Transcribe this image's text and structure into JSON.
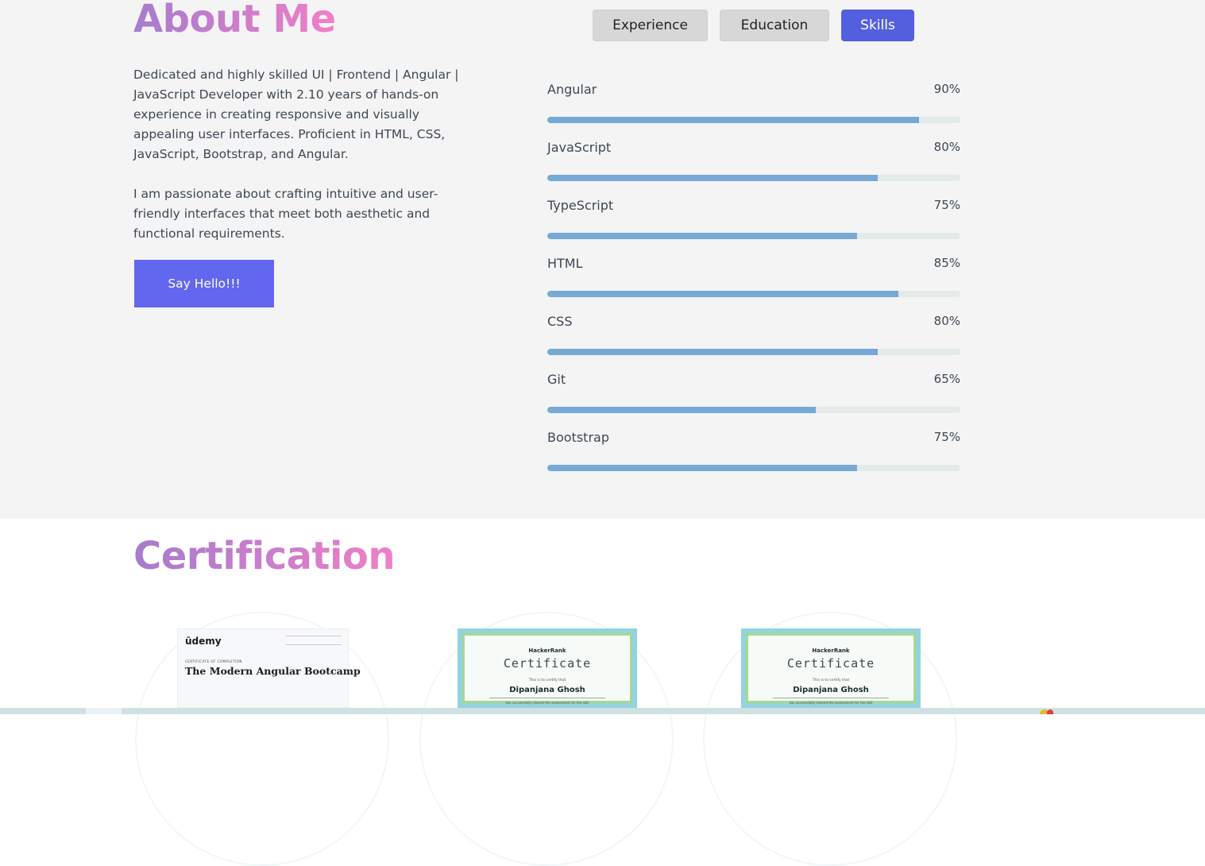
{
  "about": {
    "title": "About Me",
    "paragraph1": "Dedicated and highly skilled UI | Frontend | Angular | JavaScript Developer with 2.10 years of hands-on experience in creating responsive and visually appealing user interfaces. Proficient in HTML, CSS, JavaScript, Bootstrap, and Angular.",
    "paragraph2": "I am passionate about crafting intuitive and user-friendly interfaces that meet both aesthetic and functional requirements.",
    "cta_label": "Say Hello!!!"
  },
  "tabs": [
    {
      "label": "Experience",
      "active": false
    },
    {
      "label": "Education",
      "active": false
    },
    {
      "label": "Skills",
      "active": true
    }
  ],
  "skills": [
    {
      "name": "Angular",
      "percent_label": "90%",
      "percent": 90
    },
    {
      "name": "JavaScript",
      "percent_label": "80%",
      "percent": 80
    },
    {
      "name": "TypeScript",
      "percent_label": "75%",
      "percent": 75
    },
    {
      "name": "HTML",
      "percent_label": "85%",
      "percent": 85
    },
    {
      "name": "CSS",
      "percent_label": "80%",
      "percent": 80
    },
    {
      "name": "Git",
      "percent_label": "65%",
      "percent": 65
    },
    {
      "name": "Bootstrap",
      "percent_label": "75%",
      "percent": 75
    }
  ],
  "certification": {
    "title": "Certification",
    "cards": [
      {
        "issuer": "ūdemy",
        "course": "The Modern Angular Bootcamp",
        "caption": "CERTIFICATE OF COMPLETION"
      },
      {
        "issuer": "HackerRank",
        "heading": "Certificate",
        "certify": "This is to certify that",
        "name": "Dipanjana Ghosh",
        "sub": "has successfully cleared the assessment for the skill"
      },
      {
        "issuer": "HackerRank",
        "heading": "Certificate",
        "certify": "This is to certify that",
        "name": "Dipanjana Ghosh",
        "sub": "has successfully cleared the assessment for the skill"
      }
    ]
  },
  "colors": {
    "accent": "#6366ef",
    "active_tab": "#545fe0",
    "bar_fill": "#76a9d6",
    "bar_track": "#e4e9e9",
    "title_gradient_start": "#a67ccf",
    "title_gradient_end": "#f07fc7"
  }
}
